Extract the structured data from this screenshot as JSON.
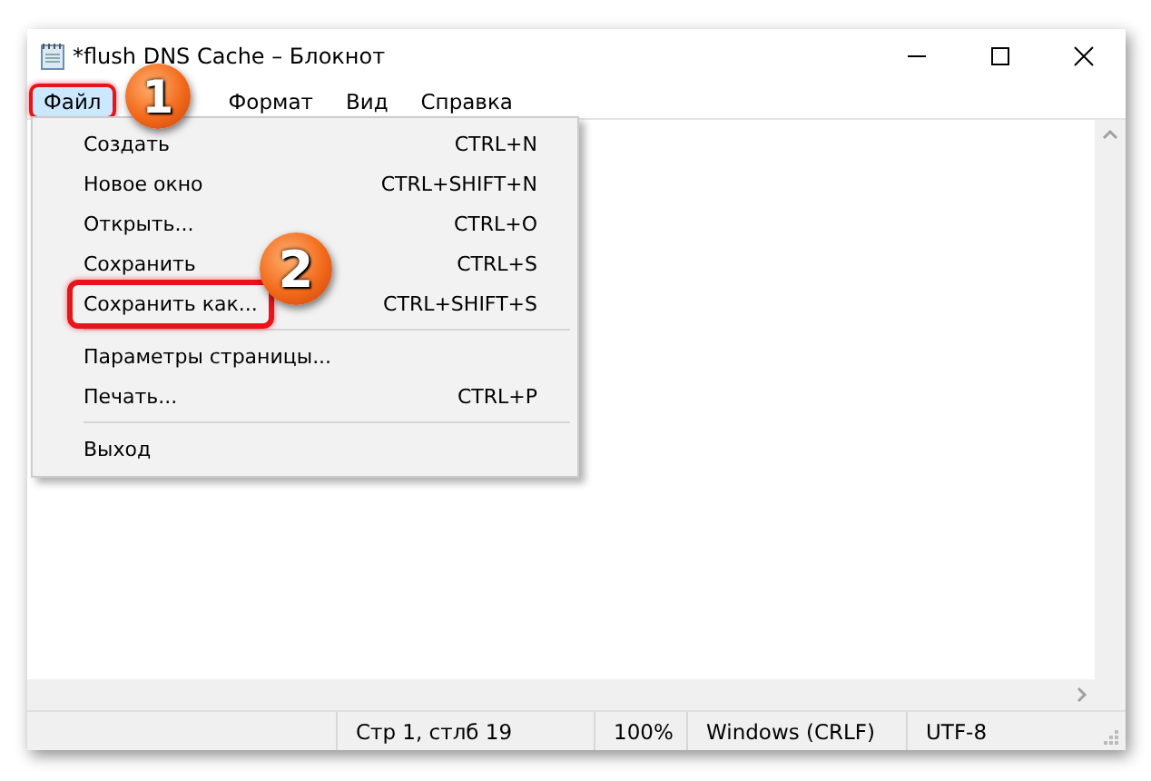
{
  "window": {
    "title": "*flush DNS Cache – Блокнот"
  },
  "menu_bar": [
    {
      "label": "Файл",
      "selected": true,
      "outlined": true
    },
    {
      "label": "Формат",
      "selected": false,
      "outlined": false
    },
    {
      "label": "Вид",
      "selected": false,
      "outlined": false
    },
    {
      "label": "Справка",
      "selected": false,
      "outlined": false
    }
  ],
  "file_menu": [
    {
      "kind": "item",
      "label": "Создать",
      "shortcut": "CTRL+N",
      "outlined": false
    },
    {
      "kind": "item",
      "label": "Новое окно",
      "shortcut": "CTRL+SHIFT+N",
      "outlined": false
    },
    {
      "kind": "item",
      "label": "Открыть...",
      "shortcut": "CTRL+O",
      "outlined": false
    },
    {
      "kind": "item",
      "label": "Сохранить",
      "shortcut": "CTRL+S",
      "outlined": false
    },
    {
      "kind": "item",
      "label": "Сохранить как...",
      "shortcut": "CTRL+SHIFT+S",
      "outlined": true
    },
    {
      "kind": "separator"
    },
    {
      "kind": "item",
      "label": "Параметры страницы...",
      "outlined": false
    },
    {
      "kind": "item",
      "label": "Печать...",
      "shortcut": "CTRL+P",
      "outlined": false
    },
    {
      "kind": "separator"
    },
    {
      "kind": "item",
      "label": "Выход",
      "outlined": false
    }
  ],
  "status_bar": [
    "Стр 1, стлб 19",
    "100%",
    "Windows (CRLF)",
    "UTF-8"
  ],
  "annotations": [
    {
      "number": "1"
    },
    {
      "number": "2"
    }
  ]
}
